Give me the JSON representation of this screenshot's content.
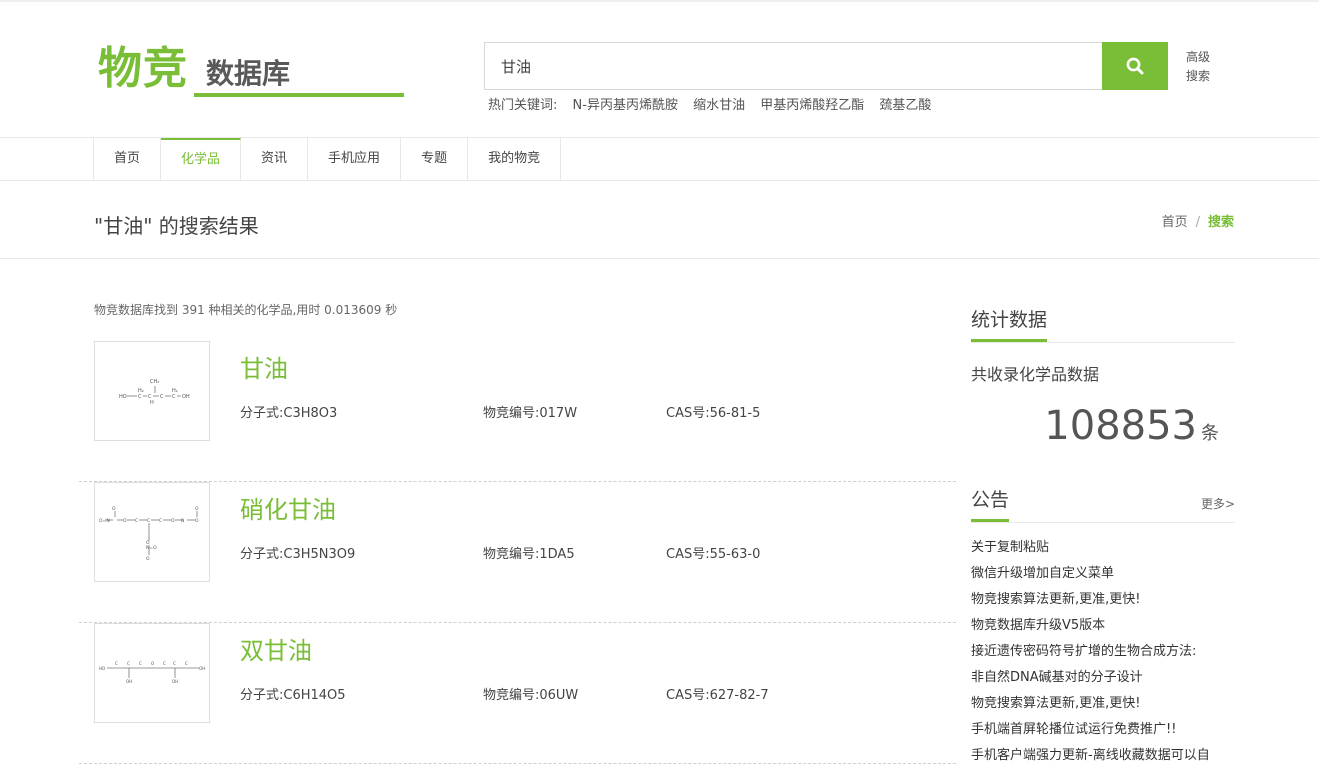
{
  "logo": {
    "big": "物竞",
    "small": "数据库"
  },
  "search": {
    "value": "甘油",
    "placeholder": "",
    "advanced": "高级搜索"
  },
  "hot": {
    "label": "热门关键词:",
    "keywords": [
      "N-异丙基丙烯酰胺",
      "缩水甘油",
      "甲基丙烯酸羟乙酯",
      "巯基乙酸"
    ]
  },
  "nav": [
    "首页",
    "化学品",
    "资讯",
    "手机应用",
    "专题",
    "我的物竞"
  ],
  "nav_active": "化学品",
  "page": {
    "title": "\"甘油\" 的搜索结果"
  },
  "breadcrumb": {
    "home": "首页",
    "sep": "/",
    "current": "搜索"
  },
  "found": "物竞数据库找到 391 种相关的化学品,用时 0.013609 秒",
  "results": [
    {
      "name": "甘油",
      "formula": "分子式:C3H8O3",
      "code": "物竞编号:017W",
      "cas": "CAS号:56-81-5"
    },
    {
      "name": "硝化甘油",
      "formula": "分子式:C3H5N3O9",
      "code": "物竞编号:1DA5",
      "cas": "CAS号:55-63-0"
    },
    {
      "name": "双甘油",
      "formula": "分子式:C6H14O5",
      "code": "物竞编号:06UW",
      "cas": "CAS号:627-82-7"
    }
  ],
  "stats": {
    "title": "统计数据",
    "label": "共收录化学品数据",
    "count": "108853",
    "unit": "条"
  },
  "notices": {
    "title": "公告",
    "more": "更多>",
    "items": [
      "关于复制粘贴",
      "微信升级增加自定义菜单",
      "物竞搜索算法更新,更准,更快!",
      "物竞数据库升级V5版本",
      "接近遗传密码符号扩增的生物合成方法:",
      "非自然DNA碱基对的分子设计",
      "物竞搜索算法更新,更准,更快!",
      "手机端首屏轮播位试运行免费推广!!",
      "手机客户端强力更新-离线收藏数据可以自"
    ]
  },
  "colors": {
    "brand": "#79be36",
    "text": "#333333",
    "border": "#e8e8e8"
  },
  "icons": {
    "search_button": "search-icon"
  }
}
